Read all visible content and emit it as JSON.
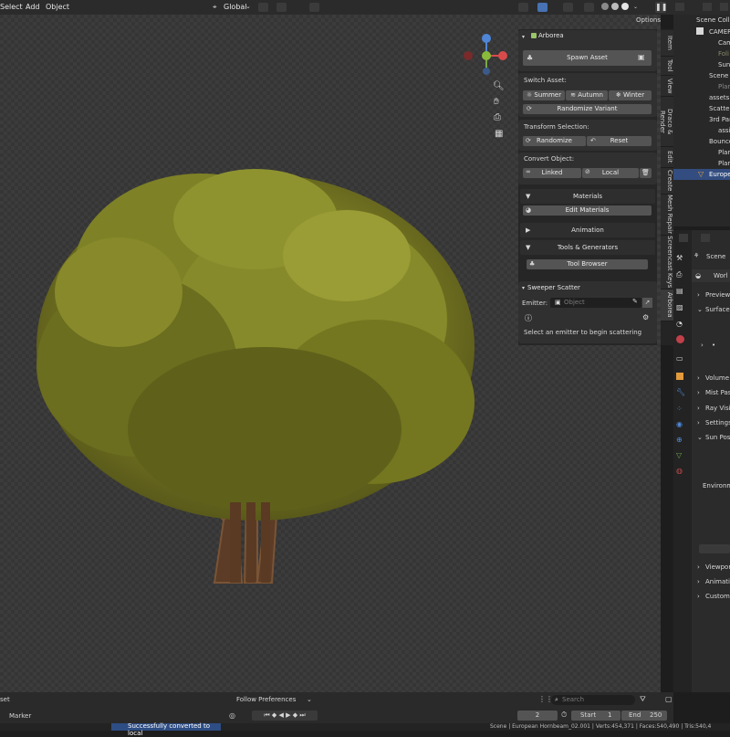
{
  "menubar": {
    "select": "Select",
    "add": "Add",
    "object": "Object",
    "orientation": "Global",
    "options": "Options"
  },
  "arborea": {
    "title": "Arborea",
    "spawn_label": "Spawn Asset",
    "switch_label": "Switch Asset:",
    "seasons": [
      "Summer",
      "Autumn",
      "Winter"
    ],
    "randomize_variant": "Randomize Variant",
    "transform_label": "Transform Selection:",
    "randomize": "Randomize",
    "reset": "Reset",
    "convert_label": "Convert Object:",
    "linked": "Linked",
    "local": "Local",
    "materials": "Materials",
    "edit_materials": "Edit Materials",
    "animation": "Animation",
    "tools": "Tools & Generators",
    "tool_browser": "Tool Browser"
  },
  "sweeper": {
    "title": "Sweeper Scatter",
    "emitter_label": "Emitter:",
    "emitter_placeholder": "Object",
    "message": "Select an emitter to begin scattering"
  },
  "vtabs": [
    "Item",
    "Tool",
    "View",
    "Draco & Render",
    "Edit",
    "Create",
    "Mesh Repair",
    "Screencast Keys",
    "Arborea"
  ],
  "outliner": {
    "items": [
      "Scene Colle",
      "CAMER",
      "Cam",
      "Foli",
      "Sun",
      "Scene",
      "Plar",
      "assets",
      "Scatter",
      "3rd Par",
      "assi",
      "Bounce",
      "Plar",
      "Plar",
      "Europe"
    ]
  },
  "properties": {
    "scene": "Scene",
    "world": "Worl",
    "sections": [
      "Preview",
      "Surface",
      "Volume",
      "Mist Pas",
      "Ray Visi",
      "Settings",
      "Sun Pos",
      "Viewpor",
      "Animati",
      "Custom"
    ],
    "environment": "Environm"
  },
  "timeline": {
    "asset": "set",
    "marker": "Marker",
    "follow": "Follow Preferences",
    "search_placeholder": "Search",
    "frame": "2",
    "start_label": "Start",
    "start": "1",
    "end_label": "End",
    "end": "250"
  },
  "status": {
    "message": "Successfully converted to local",
    "info": "Scene | European Hornbeam_02.001 | Verts:454,371 | Faces:540,490 | Tris:540,4"
  },
  "colors": {
    "accent": "#4772b3",
    "panel": "#303030",
    "button": "#545454",
    "leaf": "#8a8a2a",
    "trunk": "#6e4a2e"
  }
}
